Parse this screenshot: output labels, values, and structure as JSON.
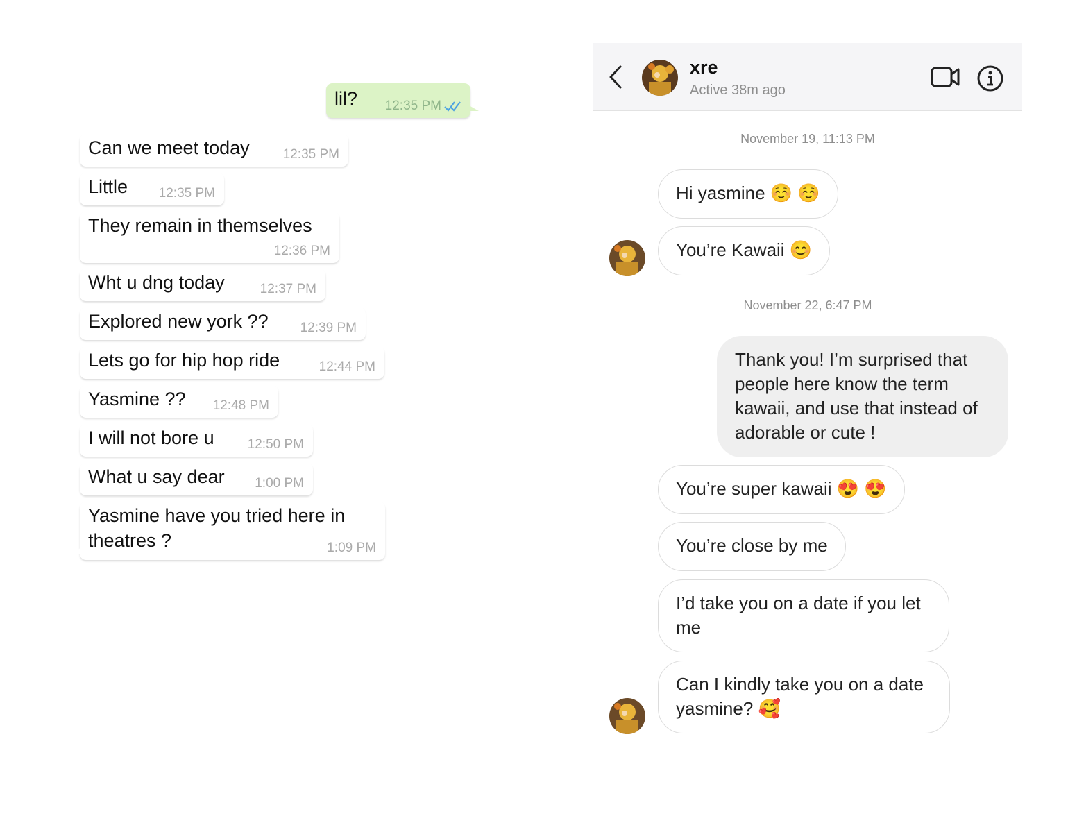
{
  "whatsapp": {
    "messages": [
      {
        "text": "lil?",
        "time": "12:35 PM",
        "direction": "outgoing",
        "read_receipt": "double-check-blue"
      },
      {
        "text": "Can we meet today",
        "time": "12:35 PM",
        "direction": "incoming"
      },
      {
        "text": "Little",
        "time": "12:35 PM",
        "direction": "incoming"
      },
      {
        "text": "They remain in themselves",
        "time": "12:36 PM",
        "direction": "incoming"
      },
      {
        "text": "Wht u dng today",
        "time": "12:37 PM",
        "direction": "incoming"
      },
      {
        "text": "Explored new york ??",
        "time": "12:39 PM",
        "direction": "incoming"
      },
      {
        "text": "Lets go for hip hop ride",
        "time": "12:44 PM",
        "direction": "incoming"
      },
      {
        "text": "Yasmine ??",
        "time": "12:48 PM",
        "direction": "incoming"
      },
      {
        "text": "I will not bore u",
        "time": "12:50 PM",
        "direction": "incoming"
      },
      {
        "text": "What u say dear",
        "time": "1:00 PM",
        "direction": "incoming"
      },
      {
        "text": "Yasmine have you tried here in theatres ?",
        "time": "1:09 PM",
        "direction": "incoming"
      }
    ],
    "colors": {
      "outgoing_bubble": "#dcf3c6",
      "incoming_bubble": "#ffffff",
      "tick": "#4fa3e0"
    }
  },
  "instagram": {
    "header": {
      "name": "xre",
      "status": "Active 38m ago",
      "back_icon": "chevron-left-icon",
      "video_icon": "video-camera-icon",
      "info_icon": "info-icon"
    },
    "dates": [
      "November 19, 11:13 PM",
      "November 22, 6:47 PM"
    ],
    "messages": [
      {
        "text": "Hi yasmine ☺️ ☺️",
        "sender": "them"
      },
      {
        "text": "You’re Kawaii 😊",
        "sender": "them"
      },
      {
        "text": "Thank you! I’m surprised that people here know the term kawaii, and use that instead of adorable or cute !",
        "sender": "me"
      },
      {
        "text": "You’re super kawaii 😍 😍",
        "sender": "them"
      },
      {
        "text": "You’re close by me",
        "sender": "them"
      },
      {
        "text": "I’d take you on a date if you let me",
        "sender": "them"
      },
      {
        "text": "Can I kindly take you on a date yasmine? 🥰",
        "sender": "them"
      }
    ],
    "colors": {
      "header_bg": "#f5f5f7",
      "my_bubble": "#efefef",
      "their_border": "#dcdcdc"
    }
  }
}
